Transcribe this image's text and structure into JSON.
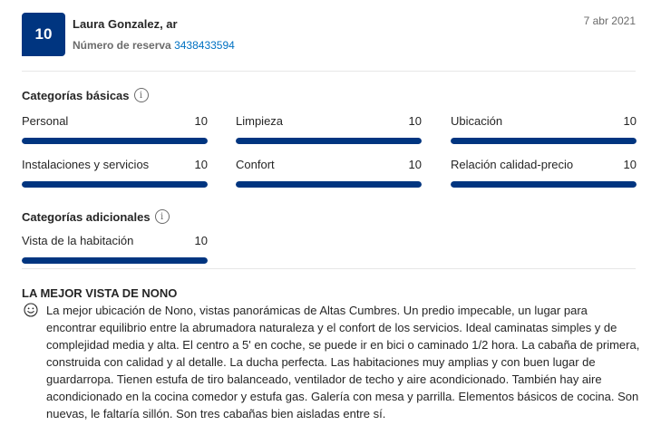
{
  "review": {
    "score": "10",
    "reviewer": "Laura Gonzalez, ar",
    "booking_label": "Número de reserva",
    "booking_number": "3438433594",
    "date": "7 abr 2021",
    "title": "LA MEJOR VISTA DE NONO",
    "body": "La mejor ubicación de Nono, vistas panorámicas de Altas Cumbres. Un predio impecable, un lugar para encontrar equilibrio entre la abrumadora naturaleza y el confort de los servicios. Ideal caminatas simples y de complejidad media y alta. El centro a 5' en coche, se puede ir en bici o caminado 1/2 hora. La cabaña de primera, construida con calidad y al detalle. La ducha perfecta. Las habitaciones muy amplias y con buen lugar de guardarropa. Tienen estufa de tiro balanceado, ventilador de techo y aire acondicionado. También hay aire acondicionado en la cocina comedor y estufa gas. Galería con mesa y parrilla. Elementos básicos de cocina. Son nuevas, le faltaría sillón. Son tres cabañas bien aisladas entre sí."
  },
  "basic": {
    "title": "Categorías básicas",
    "info_icon": "i",
    "items": [
      {
        "label": "Personal",
        "score": "10",
        "level": 1.0
      },
      {
        "label": "Limpieza",
        "score": "10",
        "level": 1.0
      },
      {
        "label": "Ubicación",
        "score": "10",
        "level": 1.0
      },
      {
        "label": "Instalaciones y servicios",
        "score": "10",
        "level": 1.0
      },
      {
        "label": "Confort",
        "score": "10",
        "level": 1.0
      },
      {
        "label": "Relación calidad-precio",
        "score": "10",
        "level": 1.0
      }
    ]
  },
  "additional": {
    "title": "Categorías adicionales",
    "info_icon": "i",
    "items": [
      {
        "label": "Vista de la habitación",
        "score": "10",
        "level": 1.0
      }
    ]
  },
  "colors": {
    "brand": "#003580",
    "link": "#0071c2"
  },
  "icons": {
    "info": "info-icon",
    "sentiment": "smile-icon"
  }
}
